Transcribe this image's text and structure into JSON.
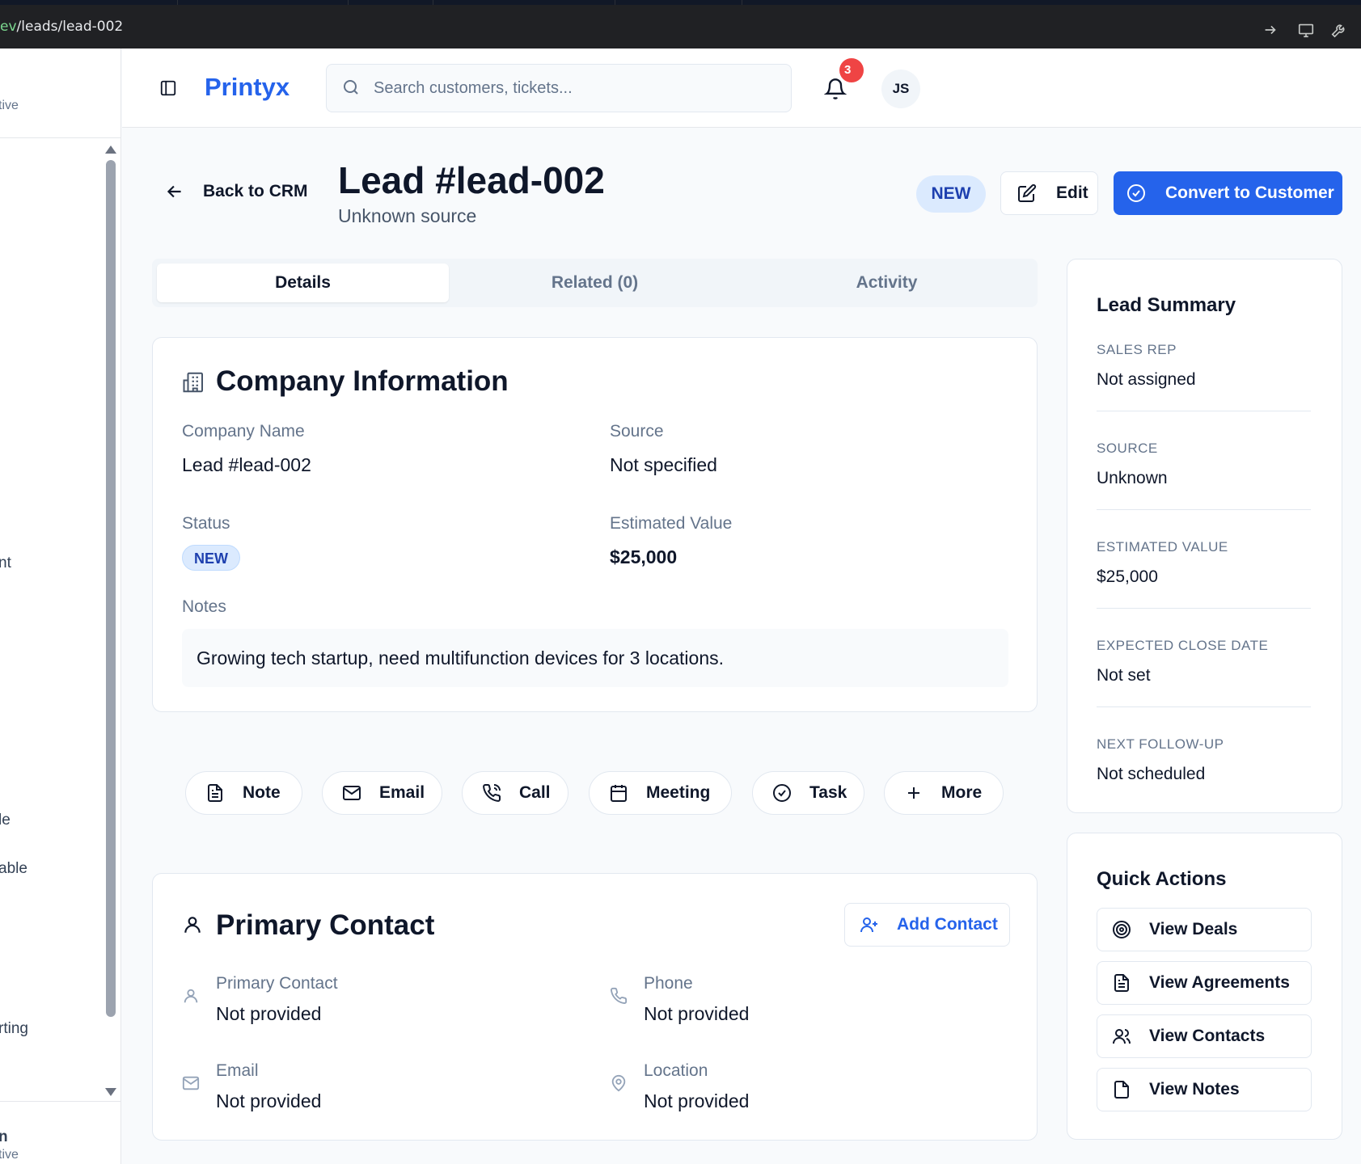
{
  "browser": {
    "url_prefix": "ev",
    "url_path": "/leads/lead-002"
  },
  "sidebar": {
    "items": [
      "tive",
      "nt",
      "le",
      "able",
      "rting",
      "n",
      "tive"
    ]
  },
  "header": {
    "logo": "Printyx",
    "search_placeholder": "Search customers, tickets...",
    "notification_count": "3",
    "avatar_initials": "JS"
  },
  "page": {
    "back_label": "Back to CRM",
    "title": "Lead #lead-002",
    "subtitle": "Unknown source",
    "status_badge": "NEW",
    "edit_label": "Edit",
    "convert_label": "Convert to Customer"
  },
  "tabs": [
    {
      "label": "Details",
      "active": true
    },
    {
      "label": "Related (0)",
      "active": false
    },
    {
      "label": "Activity",
      "active": false
    }
  ],
  "company": {
    "title": "Company Information",
    "company_name_label": "Company Name",
    "company_name": "Lead #lead-002",
    "source_label": "Source",
    "source": "Not specified",
    "status_label": "Status",
    "status": "NEW",
    "estimated_value_label": "Estimated Value",
    "estimated_value": "$25,000",
    "notes_label": "Notes",
    "notes": "Growing tech startup, need multifunction devices for 3 locations."
  },
  "activity_buttons": [
    {
      "label": "Note",
      "icon": "file-text-icon"
    },
    {
      "label": "Email",
      "icon": "mail-icon"
    },
    {
      "label": "Call",
      "icon": "phone-call-icon"
    },
    {
      "label": "Meeting",
      "icon": "calendar-icon"
    },
    {
      "label": "Task",
      "icon": "check-circle-icon"
    },
    {
      "label": "More",
      "icon": "plus-icon"
    }
  ],
  "primary_contact": {
    "title": "Primary Contact",
    "add_label": "Add Contact",
    "contact_label": "Primary Contact",
    "contact_value": "Not provided",
    "phone_label": "Phone",
    "phone_value": "Not provided",
    "email_label": "Email",
    "email_value": "Not provided",
    "location_label": "Location",
    "location_value": "Not provided"
  },
  "lead_summary": {
    "title": "Lead Summary",
    "fields": [
      {
        "label": "SALES REP",
        "value": "Not assigned"
      },
      {
        "label": "SOURCE",
        "value": "Unknown"
      },
      {
        "label": "ESTIMATED VALUE",
        "value": "$25,000"
      },
      {
        "label": "EXPECTED CLOSE DATE",
        "value": "Not set"
      },
      {
        "label": "NEXT FOLLOW-UP",
        "value": "Not scheduled"
      }
    ]
  },
  "quick_actions": {
    "title": "Quick Actions",
    "items": [
      {
        "label": "View Deals",
        "icon": "target-icon"
      },
      {
        "label": "View Agreements",
        "icon": "document-icon"
      },
      {
        "label": "View Contacts",
        "icon": "users-icon"
      },
      {
        "label": "View Notes",
        "icon": "note-icon"
      }
    ]
  },
  "colors": {
    "primary": "#2563eb",
    "badge_bg": "#dbeafe",
    "badge_text": "#1e40af",
    "alert": "#ef4444"
  }
}
